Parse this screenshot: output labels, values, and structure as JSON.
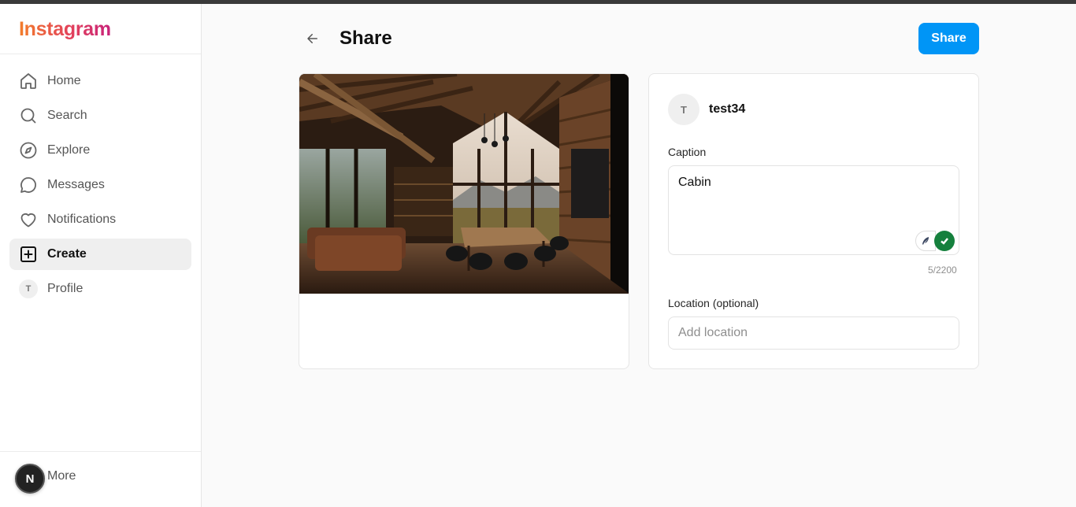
{
  "app": {
    "name": "Instagram"
  },
  "sidebar": {
    "items": [
      {
        "label": "Home",
        "icon": "home-icon"
      },
      {
        "label": "Search",
        "icon": "search-icon"
      },
      {
        "label": "Explore",
        "icon": "compass-icon"
      },
      {
        "label": "Messages",
        "icon": "message-icon"
      },
      {
        "label": "Notifications",
        "icon": "heart-icon"
      },
      {
        "label": "Create",
        "icon": "plus-square-icon",
        "active": true
      },
      {
        "label": "Profile",
        "icon": "avatar",
        "avatar_initial": "T"
      }
    ],
    "more_label": "More",
    "badge_letter": "N"
  },
  "header": {
    "title": "Share",
    "share_label": "Share"
  },
  "post": {
    "username": "test34",
    "avatar_initial": "T",
    "caption_label": "Caption",
    "caption_value": "Cabin",
    "char_count": "5/2200",
    "location_label": "Location (optional)",
    "location_placeholder": "Add location",
    "location_value": ""
  },
  "colors": {
    "accent": "#0095f6",
    "active_bg": "#efefef",
    "check": "#15803d"
  }
}
